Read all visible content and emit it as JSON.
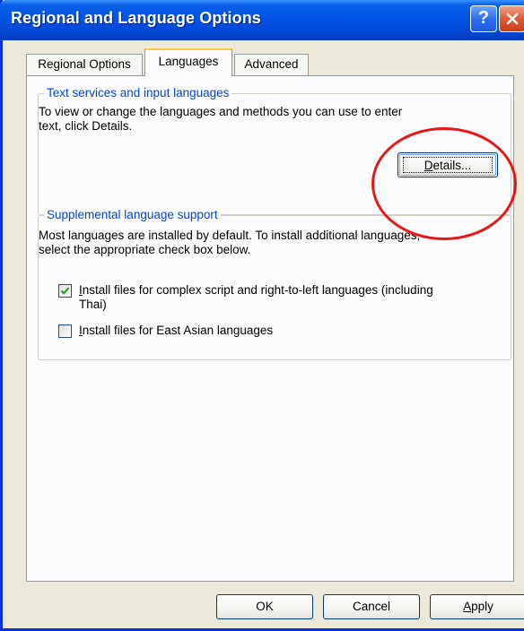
{
  "window": {
    "title": "Regional and Language Options",
    "help_glyph": "?",
    "close_glyph": "x"
  },
  "tabs": [
    {
      "label": "Regional Options",
      "selected": false
    },
    {
      "label": "Languages",
      "selected": true
    },
    {
      "label": "Advanced",
      "selected": false
    }
  ],
  "text_services": {
    "legend": "Text services and input languages",
    "description_line1": "To view or change the languages and methods you can use to enter",
    "description_line2": "text, click Details.",
    "details_label_prefix": "D",
    "details_label_rest": "etails..."
  },
  "supplemental": {
    "legend": "Supplemental language support",
    "description_line1": "Most languages are installed by default. To install additional languages,",
    "description_line2": "select the appropriate check box below.",
    "complex_script": {
      "checked": true,
      "label_prefix": "I",
      "label_line1_rest": "nstall files for complex script and right-to-left languages (including",
      "label_line2": "Thai)"
    },
    "east_asian": {
      "checked": false,
      "label_prefix": "",
      "label_prefix2": "I",
      "label_rest": "nstall files for East Asian languages",
      "label_prefix_full": "I"
    }
  },
  "footer": {
    "ok_label": "OK",
    "cancel_label": "Cancel",
    "apply_prefix": "A",
    "apply_rest": "pply"
  },
  "colors": {
    "titlebar": "#0055E5",
    "dialog_bg": "#ECE9D8",
    "legend_text": "#0046D5",
    "annotation": "#E81818"
  }
}
